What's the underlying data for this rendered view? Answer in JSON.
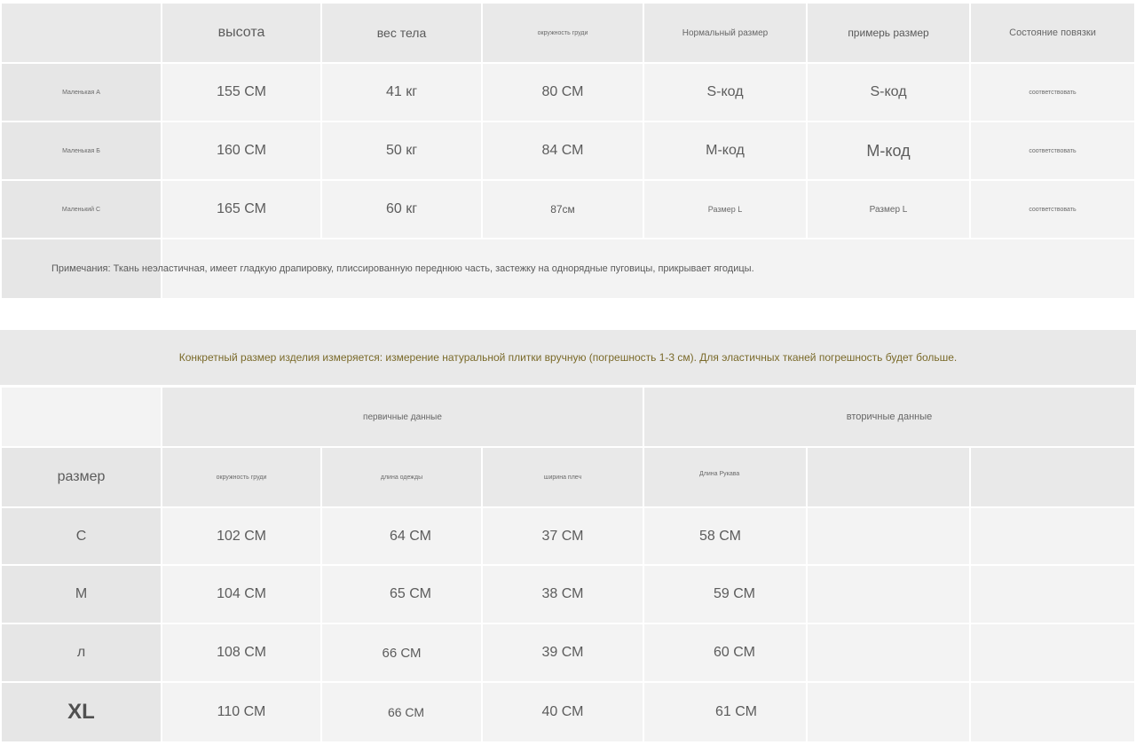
{
  "table1": {
    "headers": [
      "высота",
      "вес тела",
      "окружность груди",
      "Нормальный размер",
      "примерь размер",
      "Состояние повязки"
    ],
    "rows": [
      {
        "label": "Маленькая А",
        "height": "155 СМ",
        "weight": "41 кг",
        "chest": "80 СМ",
        "normal_size": "S-код",
        "try_size": "S-код",
        "status": "соответствовать"
      },
      {
        "label": "Маленькая Б",
        "height": "160 СМ",
        "weight": "50 кг",
        "chest": "84 СМ",
        "normal_size": "М-код",
        "try_size": "М-код",
        "status": "соответствовать"
      },
      {
        "label": "Маленький С",
        "height": "165 СМ",
        "weight": "60 кг",
        "chest": "87см",
        "normal_size": "Размер L",
        "try_size": "Размер L",
        "status": "соответствовать"
      }
    ],
    "note": "Примечания: Ткань неэластичная, имеет гладкую драпировку, плиссированную переднюю часть, застежку на однорядные пуговицы, прикрывает ягодицы."
  },
  "banner": "Конкретный размер изделия измеряется: измерение натуральной плитки вручную (погрешность 1-3 см). Для эластичных тканей погрешность будет больше.",
  "table2": {
    "group_primary": "первичные данные",
    "group_secondary": "вторичные данные",
    "size_header": "размер",
    "headers": [
      "окружность груди",
      "длина одежды",
      "ширина плеч",
      "Длина Рукава"
    ],
    "rows": [
      {
        "size": "С",
        "chest": "102 СМ",
        "length": "64 СМ",
        "shoulder": "37 СМ",
        "sleeve": "58 СМ"
      },
      {
        "size": "М",
        "chest": "104 СМ",
        "length": "65 СМ",
        "shoulder": "38 СМ",
        "sleeve": "59 СМ"
      },
      {
        "size": "л",
        "chest": "108 СМ",
        "length": "66 СМ",
        "shoulder": "39 СМ",
        "sleeve": "60 СМ"
      },
      {
        "size": "XL",
        "chest": "110 СМ",
        "length": "66 СМ",
        "shoulder": "40 СМ",
        "sleeve": "61 СМ"
      }
    ]
  }
}
